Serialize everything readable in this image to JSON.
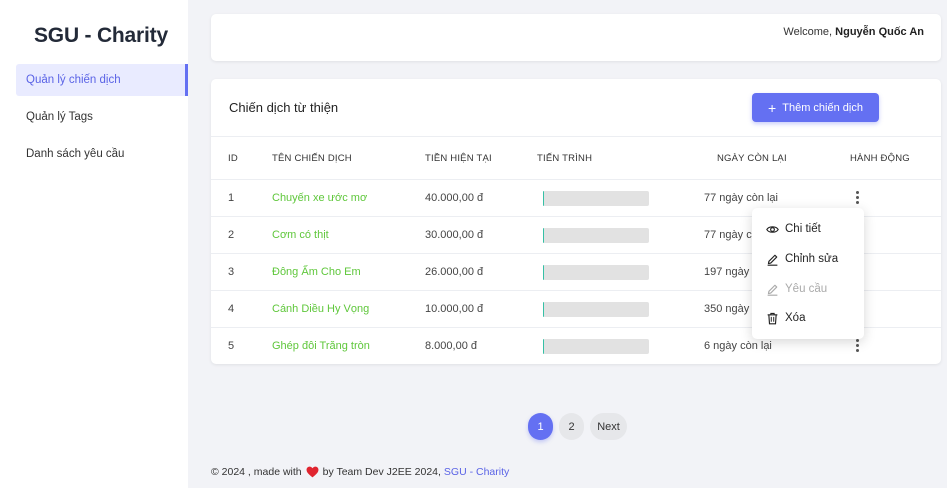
{
  "sidebar": {
    "brand": "SGU - Charity",
    "items": [
      {
        "label": "Quản lý chiến dịch",
        "active": true
      },
      {
        "label": "Quản lý Tags",
        "active": false
      },
      {
        "label": "Danh sách yêu cầu",
        "active": false
      }
    ]
  },
  "topbar": {
    "welcome_prefix": "Welcome,",
    "user_name": "Nguyễn Quốc An"
  },
  "campaigns": {
    "title": "Chiến dịch từ thiện",
    "add_label": "Thêm chiến dịch",
    "columns": {
      "id": "ID",
      "name": "TÊN CHIẾN DỊCH",
      "current": "TIỀN HIỆN TẠI",
      "progress": "TIẾN TRÌNH",
      "days": "NGÀY CÒN LẠI",
      "actions": "HÀNH ĐỘNG"
    },
    "rows": [
      {
        "id": "1",
        "name": "Chuyến xe ước mơ",
        "amount": "40.000,00 đ",
        "progress": 0.01,
        "days": "77 ngày còn lại"
      },
      {
        "id": "2",
        "name": "Cơm có thịt",
        "amount": "30.000,00 đ",
        "progress": 0.01,
        "days": "77 ngày còn lại"
      },
      {
        "id": "3",
        "name": "Đông Ấm Cho Em",
        "amount": "26.000,00 đ",
        "progress": 0.01,
        "days": "197 ngày còn lại"
      },
      {
        "id": "4",
        "name": "Cánh Diều Hy Vọng",
        "amount": "10.000,00 đ",
        "progress": 0.01,
        "days": "350 ngày còn lại"
      },
      {
        "id": "5",
        "name": "Ghép đôi Trăng tròn",
        "amount": "8.000,00 đ",
        "progress": 0.01,
        "days": "6 ngày còn lại"
      }
    ]
  },
  "action_menu": {
    "detail": "Chi tiết",
    "edit": "Chỉnh sửa",
    "requests": "Yêu cầu",
    "delete": "Xóa"
  },
  "pagination": {
    "pages": [
      "1",
      "2"
    ],
    "current": "1",
    "next": "Next"
  },
  "footer": {
    "text_before": "© 2024 , made with",
    "text_after": "by Team Dev J2EE 2024,",
    "link": "SGU - Charity"
  },
  "colors": {
    "accent": "#6470f2",
    "name_green": "#5fc73b",
    "progress_fill": "#36c0a5",
    "heart": "#e0242f"
  },
  "icons": {
    "menu": "kebab-icon",
    "detail": "eye-icon",
    "edit": "pencil-icon",
    "requests": "pencil-icon",
    "delete": "trash-icon",
    "footer": "heart-icon"
  }
}
